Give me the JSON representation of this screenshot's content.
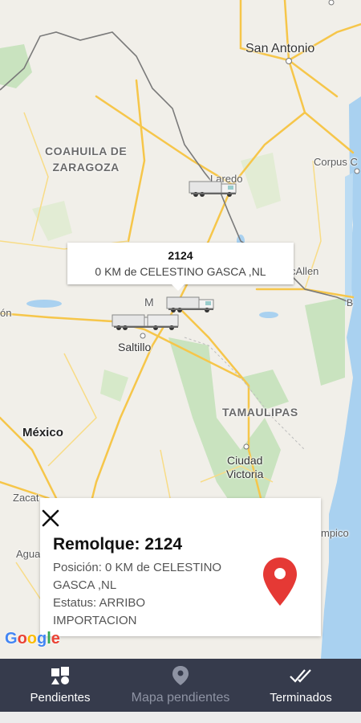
{
  "map": {
    "labels": {
      "san_antonio": "San Antonio",
      "coahuila": "COAHUILA DE\nZARAGOZA",
      "corpus": "Corpus C",
      "laredo": "Laredo",
      "mcallen": "cAllen",
      "on": "ón",
      "saltillo": "Saltillo",
      "m_partial": "M",
      "tamaulipas": "TAMAULIPAS",
      "mexico": "México",
      "ciudad_victoria": "Ciudad\nVictoria",
      "zacat": "Zacat",
      "agua": "Agua",
      "mpico": "mpico",
      "b_edge": "B"
    },
    "colors": {
      "land": "#f1efe9",
      "water": "#a9d1f0",
      "park": "#c9e3bf",
      "road": "#f6c64a",
      "border": "#6f6f6f"
    }
  },
  "tooltip": {
    "trailer": "2124",
    "position": "0  KM de CELESTINO GASCA ,NL"
  },
  "info": {
    "title": "Remolque: 2124",
    "lines": [
      "Posición: 0  KM de CELESTINO",
      "GASCA ,NL",
      "Estatus: ARRIBO",
      "IMPORTACION"
    ]
  },
  "google_logo": "Google",
  "nav": {
    "items": [
      {
        "label": "Pendientes",
        "icon": "shapes-icon",
        "active": true
      },
      {
        "label": "Mapa pendientes",
        "icon": "location-pin-icon",
        "active": false
      },
      {
        "label": "Terminados",
        "icon": "double-check-icon",
        "active": true
      }
    ],
    "colors": {
      "active": "#ffffff",
      "inactive": "#8e93a3",
      "background": "#363b4c"
    }
  },
  "pin_color": "#e53935"
}
